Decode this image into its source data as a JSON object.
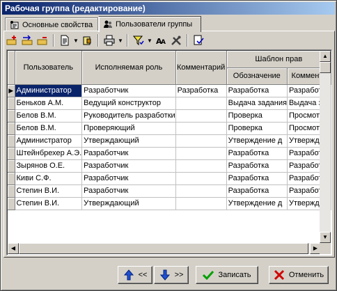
{
  "window": {
    "title": "Рабочая группа (редактирование)"
  },
  "tabs": [
    {
      "label": "Основные свойства",
      "icon": "properties-icon"
    },
    {
      "label": "Пользователи группы",
      "icon": "group-users-icon",
      "active": true
    }
  ],
  "toolbar": {
    "buttons": [
      "add-row-icon",
      "move-rows-icon",
      "delete-row-icon",
      "document-icon",
      "lock-icon",
      "print-icon",
      "filter-icon",
      "find-icon",
      "tools-icon",
      "check-list-icon"
    ]
  },
  "grid": {
    "columns": {
      "user": "Пользователь",
      "role": "Исполняемая роль",
      "comment": "Комментарий",
      "template_group": "Шаблон прав",
      "designation": "Обозначение",
      "template_comment": "Коммента"
    },
    "rows": [
      {
        "user": "Администратор",
        "role": "Разработчик",
        "comment": "Разработка",
        "designation": "Разработка",
        "tcomment": "Разработка"
      },
      {
        "user": "Беньков А.М.",
        "role": "Ведущий конструктор",
        "comment": "",
        "designation": "Выдача задания",
        "tcomment": "Выдача зад"
      },
      {
        "user": "Белов В.М.",
        "role": "Руководитель разработки",
        "comment": "",
        "designation": "Проверка",
        "tcomment": "Просмотр и"
      },
      {
        "user": "Белов В.М.",
        "role": "Проверяющий",
        "comment": "",
        "designation": "Проверка",
        "tcomment": "Просмотр и"
      },
      {
        "user": "Администратор",
        "role": "Утверждающий",
        "comment": "",
        "designation": "Утверждение д",
        "tcomment": "Утвержден"
      },
      {
        "user": "Штейнбрехер А.Э.",
        "role": "Разработчик",
        "comment": "",
        "designation": "Разработка",
        "tcomment": "Разработка"
      },
      {
        "user": "Зырянов О.Е.",
        "role": "Разработчик",
        "comment": "",
        "designation": "Разработка",
        "tcomment": "Разработка"
      },
      {
        "user": "Киви С.Ф.",
        "role": "Разработчик",
        "comment": "",
        "designation": "Разработка",
        "tcomment": "Разработка"
      },
      {
        "user": "Степин В.И.",
        "role": "Разработчик",
        "comment": "",
        "designation": "Разработка",
        "tcomment": "Разработка"
      },
      {
        "user": "Степин В.И.",
        "role": "Утверждающий",
        "comment": "",
        "designation": "Утверждение д",
        "tcomment": "Утвержден"
      }
    ]
  },
  "buttons": {
    "prev": "<<",
    "next": ">>",
    "save": "Записать",
    "cancel": "Отменить"
  },
  "colors": {
    "titlebar_start": "#0a246a",
    "titlebar_end": "#a6caf0",
    "selection": "#0a246a",
    "face": "#d4d0c8"
  }
}
